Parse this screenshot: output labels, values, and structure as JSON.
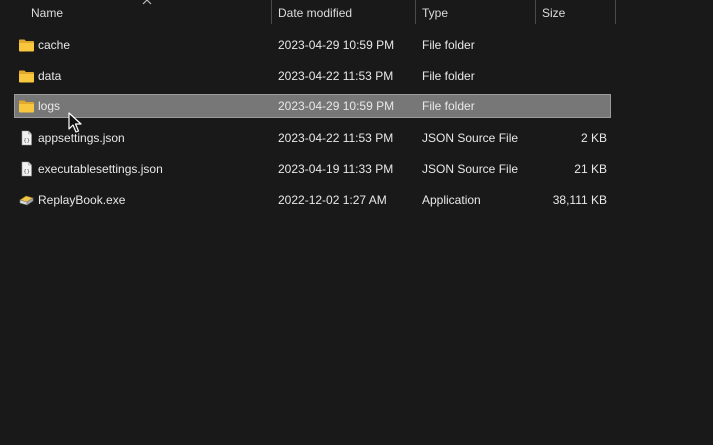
{
  "columns": {
    "name": "Name",
    "date": "Date modified",
    "type": "Type",
    "size": "Size"
  },
  "files": [
    {
      "name": "cache",
      "date": "2023-04-29 10:59 PM",
      "type": "File folder",
      "size": "",
      "icon": "folder-icon"
    },
    {
      "name": "data",
      "date": "2023-04-22 11:53 PM",
      "type": "File folder",
      "size": "",
      "icon": "folder-icon"
    },
    {
      "name": "logs",
      "date": "2023-04-29 10:59 PM",
      "type": "File folder",
      "size": "",
      "icon": "folder-icon",
      "selected": true
    },
    {
      "name": "appsettings.json",
      "date": "2023-04-22 11:53 PM",
      "type": "JSON Source File",
      "size": "2 KB",
      "icon": "json-file-icon"
    },
    {
      "name": "executablesettings.json",
      "date": "2023-04-19 11:33 PM",
      "type": "JSON Source File",
      "size": "21 KB",
      "icon": "json-file-icon"
    },
    {
      "name": "ReplayBook.exe",
      "date": "2022-12-02 1:27 AM",
      "type": "Application",
      "size": "38,111 KB",
      "icon": "application-icon"
    }
  ],
  "colors": {
    "background": "#191919",
    "selection": "#777777",
    "folder": "#f8c73d"
  }
}
